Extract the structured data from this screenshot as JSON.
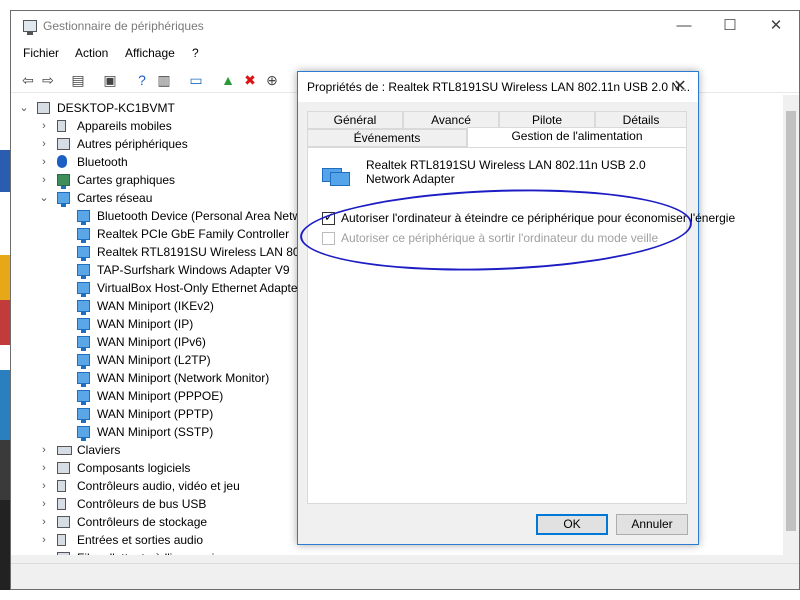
{
  "window": {
    "title": "Gestionnaire de périphériques",
    "controls": {
      "minimize": "—",
      "maximize": "☐",
      "close": "✕"
    }
  },
  "menu": [
    "Fichier",
    "Action",
    "Affichage",
    "?"
  ],
  "toolbar_icons": [
    "back-arrow-icon",
    "forward-arrow-icon",
    "properties-icon",
    "list-icon",
    "help-icon",
    "view-icon",
    "monitor-icon",
    "update-driver-icon",
    "remove-icon",
    "download-icon"
  ],
  "tree": {
    "root": "DESKTOP-KC1BVMT",
    "categories_before": [
      {
        "label": "Appareils mobiles",
        "expanded": false
      },
      {
        "label": "Autres périphériques",
        "expanded": false
      },
      {
        "label": "Bluetooth",
        "expanded": false
      },
      {
        "label": "Cartes graphiques",
        "expanded": false
      }
    ],
    "network": {
      "label": "Cartes réseau",
      "expanded": true,
      "children": [
        "Bluetooth Device (Personal Area Netw",
        "Realtek PCIe GbE Family Controller",
        "Realtek RTL8191SU Wireless LAN 802.1",
        "TAP-Surfshark Windows Adapter V9",
        "VirtualBox Host-Only Ethernet Adapte",
        "WAN Miniport (IKEv2)",
        "WAN Miniport (IP)",
        "WAN Miniport (IPv6)",
        "WAN Miniport (L2TP)",
        "WAN Miniport (Network Monitor)",
        "WAN Miniport (PPPOE)",
        "WAN Miniport (PPTP)",
        "WAN Miniport (SSTP)"
      ]
    },
    "categories_after": [
      "Claviers",
      "Composants logiciels",
      "Contrôleurs audio, vidéo et jeu",
      "Contrôleurs de bus USB",
      "Contrôleurs de stockage",
      "Entrées et sorties audio",
      "Files d'attente à l'impression :"
    ]
  },
  "dialog": {
    "title": "Propriétés de : Realtek RTL8191SU Wireless LAN 802.11n USB 2.0 N...",
    "close": "✕",
    "tabs_row1": [
      "Général",
      "Avancé",
      "Pilote",
      "Détails"
    ],
    "tabs_row2": [
      "Événements",
      "Gestion de l'alimentation"
    ],
    "active_tab": "Gestion de l'alimentation",
    "device_name": "Realtek RTL8191SU Wireless LAN 802.11n USB 2.0 Network Adapter",
    "options": [
      {
        "label": "Autoriser l'ordinateur à éteindre ce périphérique pour économiser l'énergie",
        "checked": true,
        "enabled": true
      },
      {
        "label": "Autoriser ce périphérique à sortir l'ordinateur du mode veille",
        "checked": false,
        "enabled": false
      }
    ],
    "buttons": {
      "ok": "OK",
      "cancel": "Annuler"
    }
  },
  "colors": {
    "accent": "#0078d7",
    "annotation": "#1d1dc4",
    "disabled_text": "#a0a0a0"
  }
}
